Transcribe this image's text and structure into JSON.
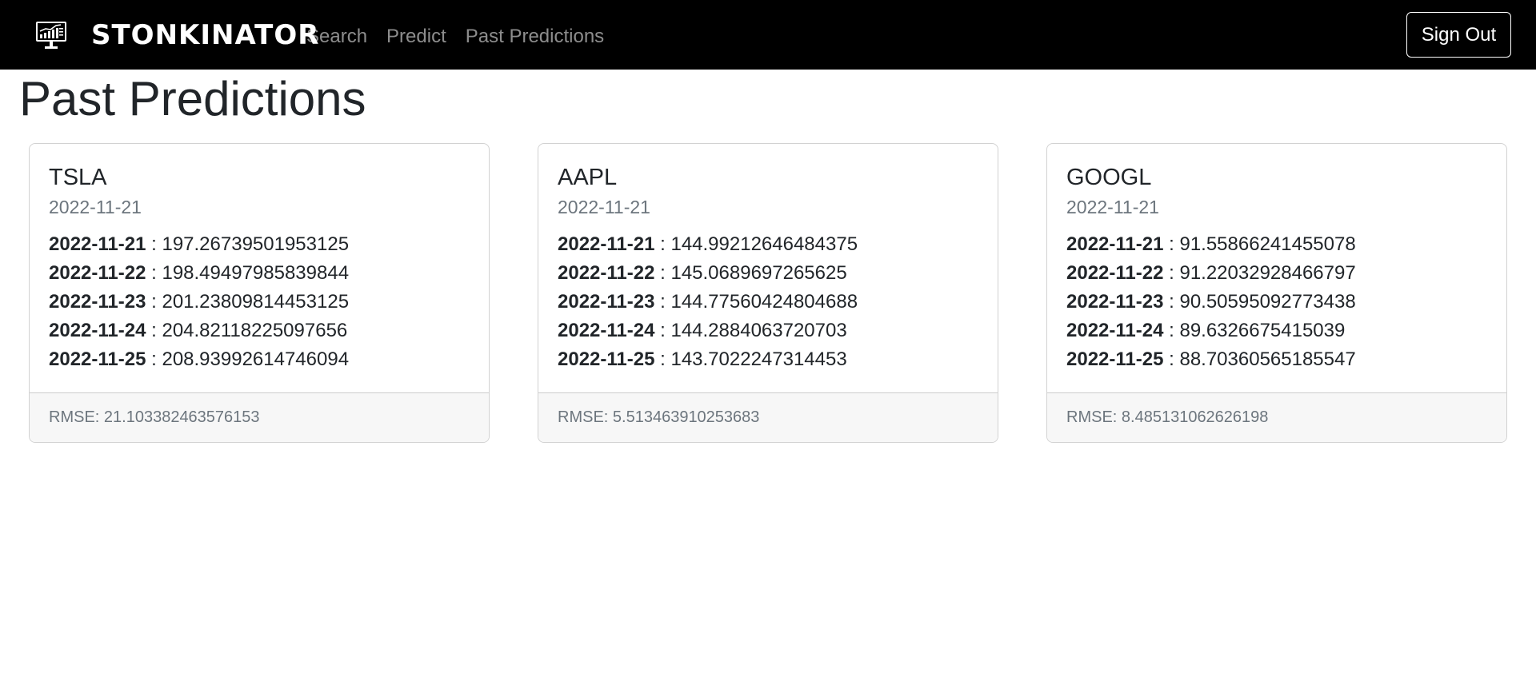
{
  "navbar": {
    "brand": "STONKINATOR",
    "logo_icon": "stock-chart-monitor-icon",
    "links": [
      "Search",
      "Predict",
      "Past Predictions"
    ],
    "sign_out": "Sign Out"
  },
  "page": {
    "title": "Past Predictions"
  },
  "cards": [
    {
      "ticker": "TSLA",
      "date": "2022-11-21",
      "predictions": [
        {
          "date": "2022-11-21",
          "value": "197.26739501953125"
        },
        {
          "date": "2022-11-22",
          "value": "198.49497985839844"
        },
        {
          "date": "2022-11-23",
          "value": "201.23809814453125"
        },
        {
          "date": "2022-11-24",
          "value": "204.82118225097656"
        },
        {
          "date": "2022-11-25",
          "value": "208.93992614746094"
        }
      ],
      "rmse": "RMSE: 21.103382463576153"
    },
    {
      "ticker": "AAPL",
      "date": "2022-11-21",
      "predictions": [
        {
          "date": "2022-11-21",
          "value": "144.99212646484375"
        },
        {
          "date": "2022-11-22",
          "value": "145.0689697265625"
        },
        {
          "date": "2022-11-23",
          "value": "144.77560424804688"
        },
        {
          "date": "2022-11-24",
          "value": "144.2884063720703"
        },
        {
          "date": "2022-11-25",
          "value": "143.7022247314453"
        }
      ],
      "rmse": "RMSE: 5.513463910253683"
    },
    {
      "ticker": "GOOGL",
      "date": "2022-11-21",
      "predictions": [
        {
          "date": "2022-11-21",
          "value": "91.55866241455078"
        },
        {
          "date": "2022-11-22",
          "value": "91.22032928466797"
        },
        {
          "date": "2022-11-23",
          "value": "90.50595092773438"
        },
        {
          "date": "2022-11-24",
          "value": "89.6326675415039"
        },
        {
          "date": "2022-11-25",
          "value": "88.70360565185547"
        }
      ],
      "rmse": "RMSE: 8.485131062626198"
    }
  ]
}
